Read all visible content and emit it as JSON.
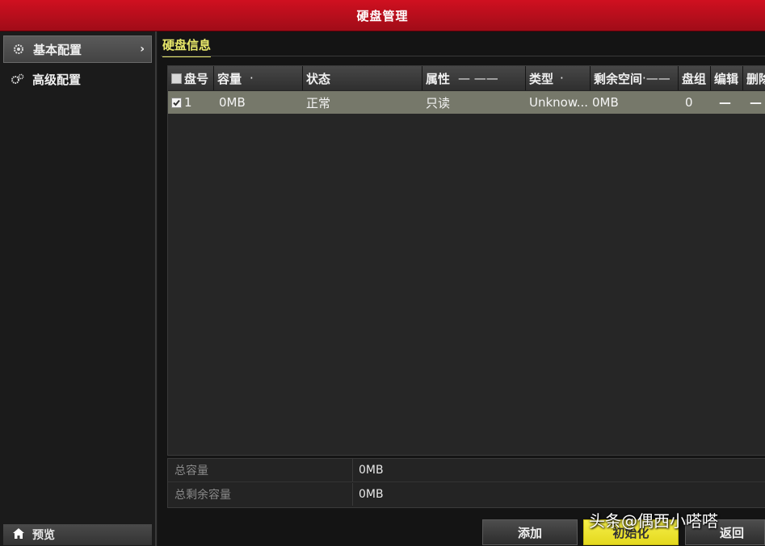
{
  "window": {
    "title": "硬盘管理"
  },
  "sidebar": {
    "items": [
      {
        "label": "基本配置",
        "icon": "gear-icon",
        "active": true,
        "chevron": "›"
      },
      {
        "label": "高级配置",
        "icon": "gears-icon",
        "active": false
      }
    ],
    "bottom": {
      "label": "预览",
      "icon": "home-icon"
    }
  },
  "main": {
    "section_tab": "硬盘信息",
    "table": {
      "columns": [
        "盘号",
        "容量",
        "状态",
        "属性",
        "类型",
        "剩余空间",
        "盘组",
        "编辑",
        "删除"
      ],
      "header_suffixes": [
        "",
        "·",
        "",
        "— ——",
        "·",
        "·——",
        "",
        "",
        ""
      ],
      "rows": [
        {
          "checked": true,
          "disk_no": "1",
          "capacity": "0MB",
          "status": "正常",
          "property": "只读",
          "type": "Unknow...",
          "free_space": "0MB",
          "group": "0",
          "edit": "—",
          "delete": "—"
        }
      ]
    },
    "summary": {
      "total_capacity_label": "总容量",
      "total_capacity_value": "0MB",
      "total_free_label": "总剩余容量",
      "total_free_value": "0MB"
    },
    "buttons": {
      "add": "添加",
      "init": "初始化",
      "back": "返回"
    }
  },
  "watermark": "头条@偶西小嗒嗒",
  "colors": {
    "titlebar": "#c0101e",
    "tab_accent": "#e8e86a",
    "row_highlight": "#76786a",
    "init_button": "#f0e83a"
  }
}
